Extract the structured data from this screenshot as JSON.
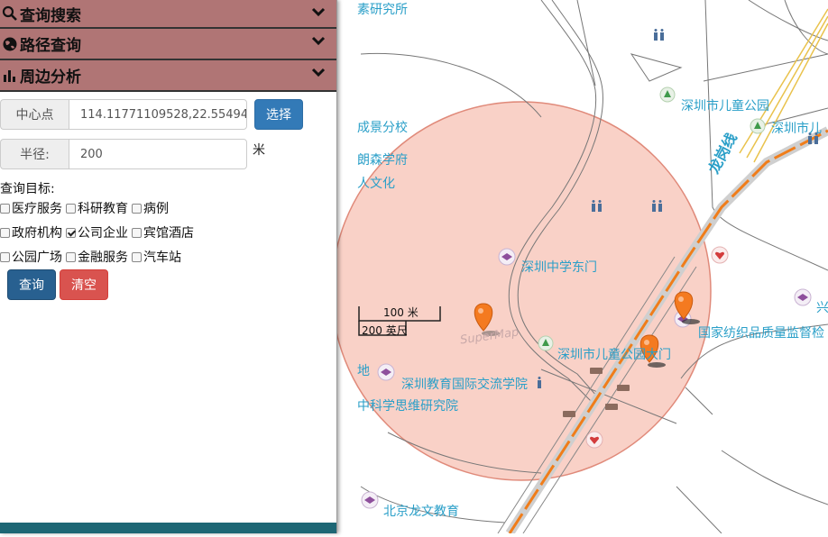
{
  "panel": {
    "sections": [
      {
        "title": "查询搜索"
      },
      {
        "title": "路径查询"
      },
      {
        "title": "周边分析"
      }
    ],
    "center": {
      "label": "中心点",
      "value": "114.11771109528,22.55494",
      "button": "选择"
    },
    "radius": {
      "label": "半径:",
      "value": "200",
      "unit": "米"
    },
    "target_label": "查询目标:",
    "targets": [
      [
        {
          "label": "医疗服务",
          "checked": false
        },
        {
          "label": "科研教育",
          "checked": false
        },
        {
          "label": "病例",
          "checked": false
        }
      ],
      [
        {
          "label": "政府机构",
          "checked": false
        },
        {
          "label": "公司企业",
          "checked": true
        },
        {
          "label": "宾馆酒店",
          "checked": false
        }
      ],
      [
        {
          "label": "公园广场",
          "checked": false
        },
        {
          "label": "金融服务",
          "checked": false
        },
        {
          "label": "汽车站",
          "checked": false
        }
      ]
    ],
    "buttons": {
      "query": "查询",
      "clear": "清空"
    }
  },
  "map": {
    "labels": {
      "l1": "素研究所",
      "l2": "深圳市儿童公园",
      "l3": "深圳市儿",
      "l4": "成景分校",
      "l5": "朗森学府",
      "l6": "人文化",
      "l7": "龙岗线",
      "l8": "深圳中学东门",
      "l9": "国家纺织品质量监督检",
      "l10": "深圳市儿童公园大门",
      "l11": "地",
      "l12": "深圳教育国际交流学院",
      "l13": "中科学思维研究院",
      "l14": "北京龙文教育",
      "l15": "兴",
      "l16": "SuperMap"
    },
    "scale": {
      "metric": "100 米",
      "imperial": "200 英尺"
    },
    "colors": {
      "buffer_fill": "#f8c9bd",
      "buffer_stroke": "#e08a7a",
      "rail": "#f07d1a",
      "label": "#2a9fc8",
      "marker": "#f47a20"
    }
  }
}
